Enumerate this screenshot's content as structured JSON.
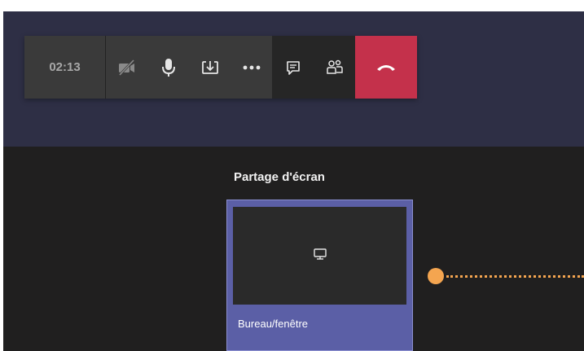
{
  "toolbar": {
    "timer": "02:13",
    "buttons": [
      {
        "name": "camera-off-icon"
      },
      {
        "name": "microphone-icon"
      },
      {
        "name": "share-tray-icon"
      },
      {
        "name": "more-options-icon"
      },
      {
        "name": "chat-icon"
      },
      {
        "name": "participants-icon"
      },
      {
        "name": "hang-up-icon"
      }
    ]
  },
  "share": {
    "title": "Partage d'écran",
    "option_label": "Bureau/fenêtre",
    "option_icon": "monitor-icon"
  },
  "colors": {
    "top_background": "#2e2f45",
    "lower_background": "#201f1f",
    "toolbar_background": "#3a3a3a",
    "hangup": "#c4314b",
    "share_card": "#5b5fa6",
    "annotation": "#f4a550"
  }
}
